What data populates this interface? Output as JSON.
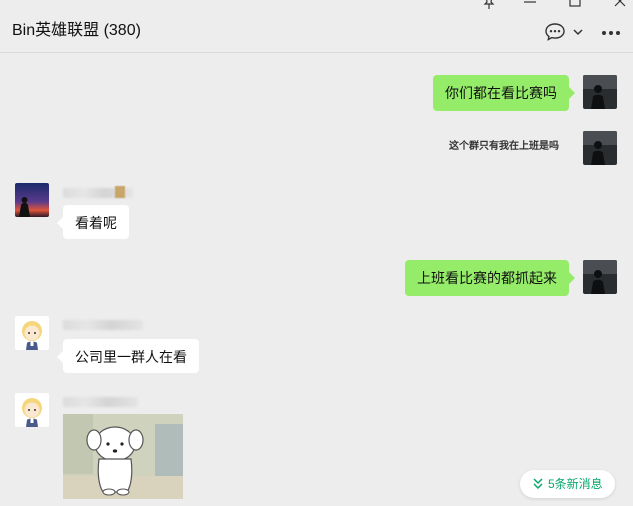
{
  "header": {
    "title": "Bin英雄联盟 (380)"
  },
  "messages": [
    {
      "side": "me",
      "text": "你们都在看比赛吗"
    },
    {
      "side": "me",
      "text": "这个群只有我在上班是吗"
    },
    {
      "side": "other",
      "text": "看着呢"
    },
    {
      "side": "me",
      "text": "上班看比赛的都抓起来"
    },
    {
      "side": "other",
      "text": "公司里一群人在看"
    },
    {
      "side": "other",
      "type": "sticker"
    }
  ],
  "new_messages_button": {
    "label": "5条新消息"
  },
  "colors": {
    "my_bubble": "#95ec69",
    "other_bubble": "#ffffff",
    "background": "#ededed",
    "accent_green": "#07a86b"
  },
  "icons": [
    "pin-icon",
    "minimize-icon",
    "maximize-icon",
    "close-icon",
    "chat-bubble-icon",
    "chevron-down-icon",
    "more-icon",
    "double-chevron-down-icon"
  ]
}
